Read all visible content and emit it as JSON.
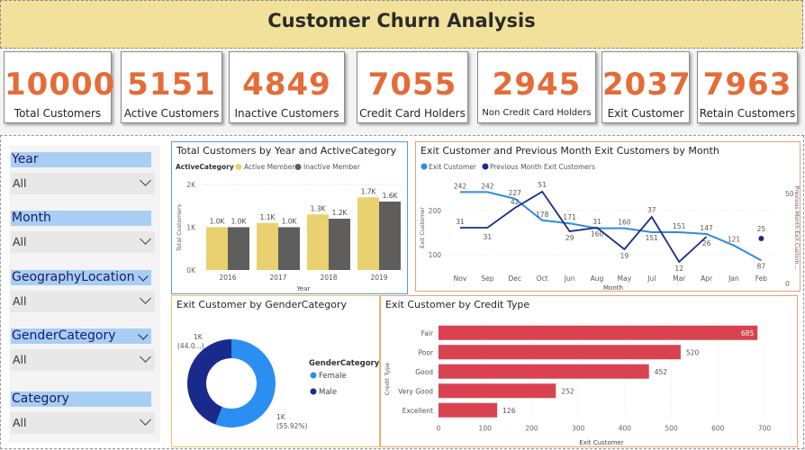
{
  "title": "Customer Churn Analysis",
  "kpis": [
    {
      "value": "10000",
      "label": "Total Customers"
    },
    {
      "value": "5151",
      "label": "Active Customers"
    },
    {
      "value": "4849",
      "label": "Inactive Customers"
    },
    {
      "value": "7055",
      "label": "Credit Card Holders"
    },
    {
      "value": "2945",
      "label": "Non Credit Card Holders"
    },
    {
      "value": "2037",
      "label": "Exit Customer"
    },
    {
      "value": "7963",
      "label": "Retain Customers"
    }
  ],
  "slicers": [
    {
      "title": "Year",
      "value": "All"
    },
    {
      "title": "Month",
      "value": "All"
    },
    {
      "title": "GeographyLocation",
      "value": "All"
    },
    {
      "title": "GenderCategory",
      "value": "All"
    },
    {
      "title": "Category",
      "value": "All"
    }
  ],
  "colors": {
    "accent": "#e46c38",
    "header": "#f1e19b",
    "active": "#e8d16e",
    "inactive": "#605e5c",
    "exit": "#2d8ce0",
    "prev": "#1a2a8c",
    "female": "#2a8ff0",
    "male": "#1a2a8c",
    "credit": "#d9434f"
  },
  "chart_data": [
    {
      "type": "bar",
      "title": "Total Customers by Year and ActiveCategory",
      "legend_title": "ActiveCategory",
      "xlabel": "Year",
      "ylabel": "Total Customers",
      "categories": [
        "2016",
        "2017",
        "2018",
        "2019"
      ],
      "yticks": [
        "0K",
        "1K",
        "2K"
      ],
      "ylim": [
        0,
        2000
      ],
      "series": [
        {
          "name": "Active Member",
          "values": [
            1000,
            1100,
            1300,
            1700
          ],
          "labels": [
            "1.0K",
            "1.1K",
            "1.3K",
            "1.7K"
          ]
        },
        {
          "name": "Inactive Member",
          "values": [
            1000,
            1000,
            1200,
            1600
          ],
          "labels": [
            "1.0K",
            "1.0K",
            "1.2K",
            "1.6K"
          ]
        }
      ]
    },
    {
      "type": "line",
      "title": "Exit Customer and Previous Month Exit Customers by Month",
      "xlabel": "Month",
      "ylabel": "Exit Customer",
      "ylabel_right": "Previous Month Exit Custom...",
      "categories": [
        "Nov",
        "Sep",
        "Dec",
        "Oct",
        "Jun",
        "Aug",
        "May",
        "Jul",
        "Mar",
        "Apr",
        "Jan",
        "Feb"
      ],
      "yticks_left": [
        "100",
        "200"
      ],
      "yticks_right": [
        "0",
        "50"
      ],
      "series": [
        {
          "name": "Exit Customer",
          "values": [
            242,
            242,
            227,
            178,
            171,
            160,
            160,
            151,
            151,
            147,
            121,
            87
          ]
        },
        {
          "name": "Previous Month Exit Customers",
          "values": [
            31,
            31,
            42,
            51,
            29,
            31,
            19,
            37,
            12,
            26,
            null,
            25
          ]
        }
      ]
    },
    {
      "type": "pie",
      "title": "Exit Customer by GenderCategory",
      "legend_title": "GenderCategory",
      "slices": [
        {
          "name": "Female",
          "value": 55.92,
          "label_top": "1K",
          "label_bottom": "(55.92%)"
        },
        {
          "name": "Male",
          "value": 44.08,
          "label_top": "1K",
          "label_bottom": "(44.0...)"
        }
      ]
    },
    {
      "type": "bar",
      "title": "Exit Customer by Credit Type",
      "xlabel": "Exit Customer",
      "ylabel": "Credit Type",
      "categories": [
        "Fair",
        "Poor",
        "Good",
        "Very Good",
        "Excellent"
      ],
      "values": [
        685,
        520,
        452,
        252,
        126
      ],
      "xticks": [
        "0",
        "100",
        "200",
        "300",
        "400",
        "500",
        "600",
        "700"
      ],
      "xlim": [
        0,
        700
      ]
    }
  ]
}
